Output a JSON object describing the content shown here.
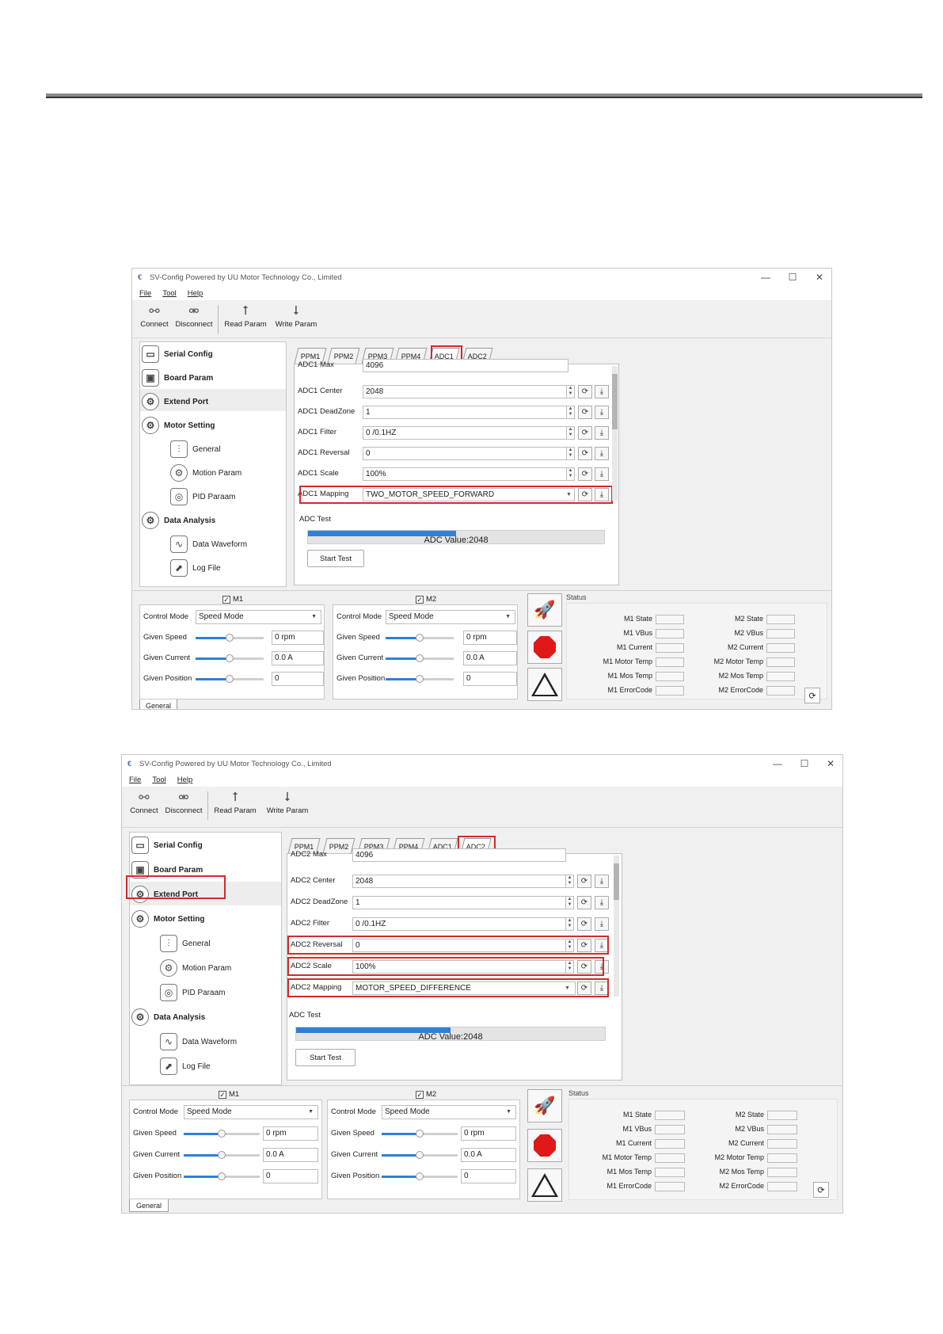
{
  "window": {
    "title": "SV-Config Powered by UU Motor Technology Co., Limited",
    "minimize_glyph": "—",
    "maximize_glyph": "☐",
    "close_glyph": "✕"
  },
  "menu": [
    "File",
    "Tool",
    "Help"
  ],
  "toolbar": {
    "connect": "Connect",
    "disconnect": "Disconnect",
    "read_param": "Read Param",
    "write_param": "Write Param"
  },
  "tree": {
    "serial_config": "Serial Config",
    "board_param": "Board Param",
    "extend_port": "Extend Port",
    "motor_setting": "Motor Setting",
    "general": "General",
    "motion_param": "Motion Param",
    "pid_param": "PID Paraam",
    "data_analysis": "Data Analysis",
    "data_waveform": "Data Waveform",
    "log_file": "Log File"
  },
  "tabs": [
    "PPM1",
    "PPM2",
    "PPM3",
    "PPM4",
    "ADC1",
    "ADC2"
  ],
  "screen1": {
    "active_tab": "ADC1",
    "cut_row": {
      "label": "ADC1 Max",
      "value": "4096"
    },
    "rows": [
      {
        "label": "ADC1 Center",
        "value": "2048"
      },
      {
        "label": "ADC1 DeadZone",
        "value": "1"
      },
      {
        "label": "ADC1 Filter",
        "value": "0 /0.1HZ"
      },
      {
        "label": "ADC1 Reversal",
        "value": "0"
      },
      {
        "label": "ADC1 Scale",
        "value": "100%"
      },
      {
        "label": "ADC1 Mapping",
        "value": "TWO_MOTOR_SPEED_FORWARD"
      }
    ]
  },
  "screen2": {
    "active_tab": "ADC2",
    "cut_row": {
      "label": "ADC2 Max",
      "value": "4096"
    },
    "rows": [
      {
        "label": "ADC2 Center",
        "value": "2048"
      },
      {
        "label": "ADC2 DeadZone",
        "value": "1"
      },
      {
        "label": "ADC2 Filter",
        "value": "0 /0.1HZ"
      },
      {
        "label": "ADC2 Reversal",
        "value": "0"
      },
      {
        "label": "ADC2 Scale",
        "value": "100%"
      },
      {
        "label": "ADC2 Mapping",
        "value": "MOTOR_SPEED_DIFFERENCE"
      }
    ]
  },
  "adc_test": {
    "label": "ADC Test",
    "value_text": "ADC Value:2048",
    "progress_fraction": 0.5,
    "start_button": "Start Test"
  },
  "motor_panel": {
    "m1_header": "M1",
    "m2_header": "M2",
    "check_glyph": "✓",
    "control_mode_label": "Control Mode",
    "control_mode_value": "Speed Mode",
    "given_speed_label": "Given Speed",
    "given_speed_value": "0 rpm",
    "given_current_label": "Given Current",
    "given_current_value": "0.0 A",
    "given_position_label": "Given Position",
    "given_position_value": "0",
    "slider_fraction": 0.5
  },
  "status": {
    "title": "Status",
    "m1": [
      "M1 State",
      "M1 VBus",
      "M1 Current",
      "M1 Motor Temp",
      "M1 Mos Temp",
      "M1 ErrorCode"
    ],
    "m2": [
      "M2 State",
      "M2 VBus",
      "M2 Current",
      "M2 Motor Temp",
      "M2 Mos Temp",
      "M2 ErrorCode"
    ]
  },
  "bottom_tab": "General",
  "icons": {
    "connect": "plug-icon",
    "disconnect": "unplug-icon",
    "read": "upload-arrow-icon",
    "write": "download-arrow-icon",
    "refresh": "refresh-icon",
    "download": "download-icon",
    "rocket": "rocket-icon",
    "stop": "stop-icon",
    "warning": "warning-icon"
  },
  "colors": {
    "highlight_red": "#d42a2a",
    "progress_blue": "#2f80d6",
    "stop_red": "#e01818"
  }
}
